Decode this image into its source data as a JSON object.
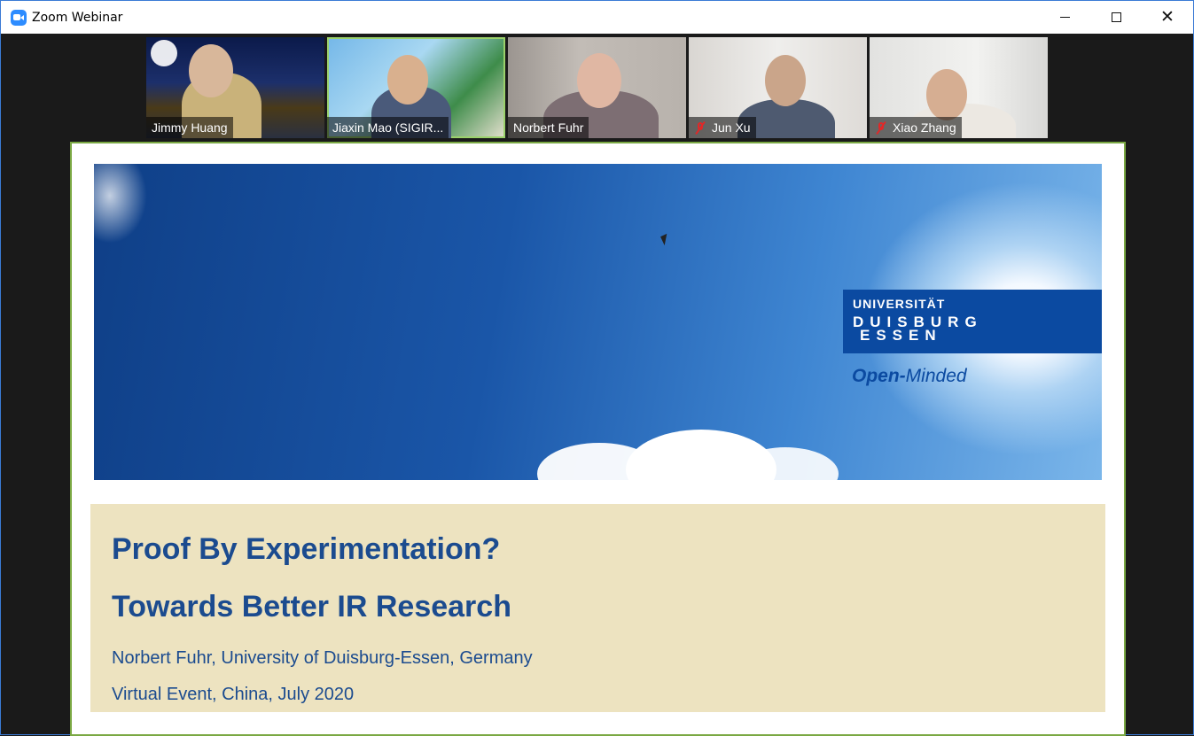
{
  "window": {
    "title": "Zoom Webinar",
    "icon": "zoom-app-icon",
    "controls": {
      "minimize": "minimize",
      "maximize": "maximize",
      "close": "✕"
    }
  },
  "participants": [
    {
      "name": "Jimmy Huang",
      "muted": false,
      "active": false
    },
    {
      "name": "Jiaxin Mao (SIGIR...",
      "muted": false,
      "active": true
    },
    {
      "name": "Norbert Fuhr",
      "muted": false,
      "active": false
    },
    {
      "name": "Jun Xu",
      "muted": true,
      "active": false
    },
    {
      "name": "Xiao Zhang",
      "muted": true,
      "active": false
    }
  ],
  "slide": {
    "logo": {
      "line1": "UNIVERSITÄT",
      "line2": "DUISBURG",
      "line3": "ESSEN",
      "tagline_bold": "Open-",
      "tagline_rest": "Minded"
    },
    "title": "Proof By Experimentation?",
    "subtitle": "Towards Better IR Research",
    "author": "Norbert Fuhr, University of Duisburg-Essen, Germany",
    "event": "Virtual Event, China, July 2020"
  },
  "colors": {
    "slide_frame_border": "#7aa843",
    "uni_blue": "#0b4aa1",
    "text_blue": "#1b4b8f",
    "info_bg": "#ede3c0",
    "muted_red": "#e02828"
  }
}
